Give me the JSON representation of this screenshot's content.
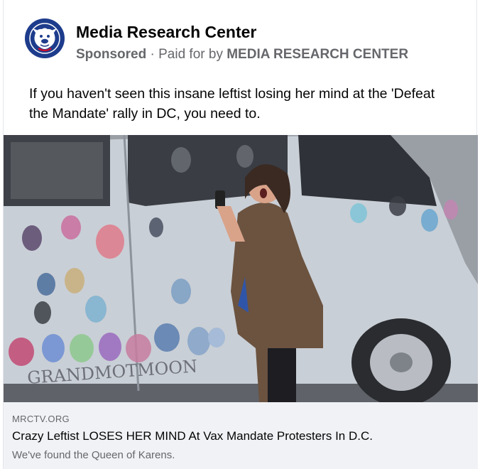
{
  "post": {
    "page_name": "Media Research Center",
    "sponsored_label": "Sponsored",
    "separator": "·",
    "paid_for_prefix": "Paid for by",
    "paid_for_entity": "MEDIA RESEARCH CENTER",
    "text": "If you haven't seen this insane leftist losing her mind at the 'Defeat the Mandate' rally in DC, you need to.",
    "avatar_icon": "bulldog-logo-icon",
    "media_image": "woman-yelling-next-to-handprint-painted-van-photo",
    "van_lettering": "GRANDMOTMOON"
  },
  "link": {
    "domain": "MRCTV.ORG",
    "headline": "Crazy Leftist LOSES HER MIND At Vax Mandate Protesters In D.C.",
    "description": "We've found the Queen of Karens."
  },
  "colors": {
    "brand_blue": "#1e3c8c",
    "text_primary": "#050505",
    "text_secondary": "#65676b",
    "link_bg": "#f0f2f5"
  }
}
